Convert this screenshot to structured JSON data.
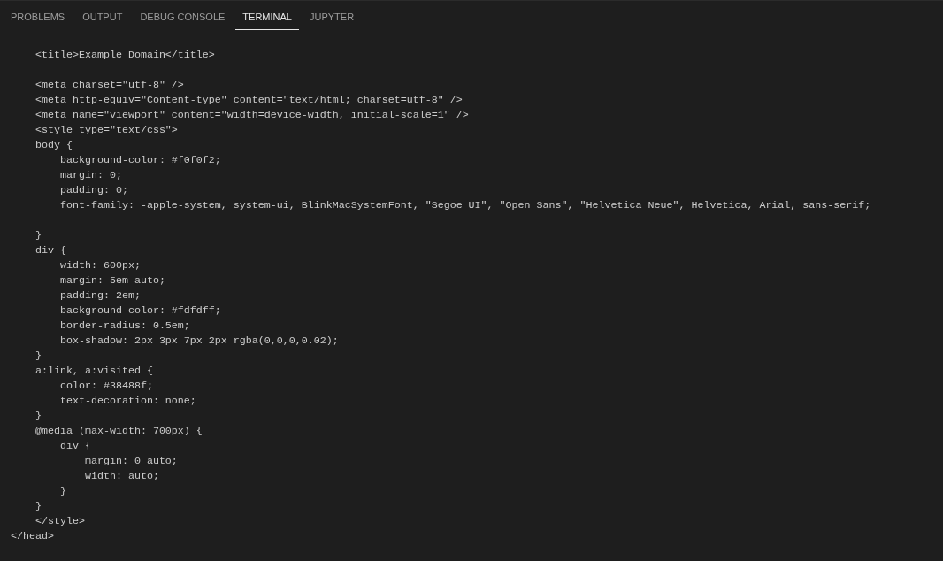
{
  "tabs": [
    {
      "label": "PROBLEMS",
      "selected": false
    },
    {
      "label": "OUTPUT",
      "selected": false
    },
    {
      "label": "DEBUG CONSOLE",
      "selected": false
    },
    {
      "label": "TERMINAL",
      "selected": true
    },
    {
      "label": "JUPYTER",
      "selected": false
    }
  ],
  "terminal": {
    "lines": [
      {
        "text": "    <title>Example Domain</title>",
        "blank_line_before": false
      },
      {
        "text": "    <meta charset=\"utf-8\" />",
        "blank_line_before": true
      },
      {
        "text": "    <meta http-equiv=\"Content-type\" content=\"text/html; charset=utf-8\" />",
        "blank_line_before": false
      },
      {
        "text": "    <meta name=\"viewport\" content=\"width=device-width, initial-scale=1\" />",
        "blank_line_before": false
      },
      {
        "text": "    <style type=\"text/css\">",
        "blank_line_before": false
      },
      {
        "text": "    body {",
        "blank_line_before": false
      },
      {
        "text": "        background-color: #f0f0f2;",
        "blank_line_before": false
      },
      {
        "text": "        margin: 0;",
        "blank_line_before": false
      },
      {
        "text": "        padding: 0;",
        "blank_line_before": false
      },
      {
        "text": "        font-family: -apple-system, system-ui, BlinkMacSystemFont, \"Segoe UI\", \"Open Sans\", \"Helvetica Neue\", Helvetica, Arial, sans-serif;",
        "blank_line_before": false
      },
      {
        "text": "    }",
        "blank_line_before": true
      },
      {
        "text": "    div {",
        "blank_line_before": false
      },
      {
        "text": "        width: 600px;",
        "blank_line_before": false
      },
      {
        "text": "        margin: 5em auto;",
        "blank_line_before": false
      },
      {
        "text": "        padding: 2em;",
        "blank_line_before": false
      },
      {
        "text": "        background-color: #fdfdff;",
        "blank_line_before": false
      },
      {
        "text": "        border-radius: 0.5em;",
        "blank_line_before": false
      },
      {
        "text": "        box-shadow: 2px 3px 7px 2px rgba(0,0,0,0.02);",
        "blank_line_before": false
      },
      {
        "text": "    }",
        "blank_line_before": false
      },
      {
        "text": "    a:link, a:visited {",
        "blank_line_before": false
      },
      {
        "text": "        color: #38488f;",
        "blank_line_before": false
      },
      {
        "text": "        text-decoration: none;",
        "blank_line_before": false
      },
      {
        "text": "    }",
        "blank_line_before": false
      },
      {
        "text": "    @media (max-width: 700px) {",
        "blank_line_before": false
      },
      {
        "text": "        div {",
        "blank_line_before": false
      },
      {
        "text": "            margin: 0 auto;",
        "blank_line_before": false
      },
      {
        "text": "            width: auto;",
        "blank_line_before": false
      },
      {
        "text": "        }",
        "blank_line_before": false
      },
      {
        "text": "    }",
        "blank_line_before": false
      },
      {
        "text": "    </style>",
        "blank_line_before": false
      },
      {
        "text": "</head>",
        "blank_line_before": false
      }
    ]
  }
}
